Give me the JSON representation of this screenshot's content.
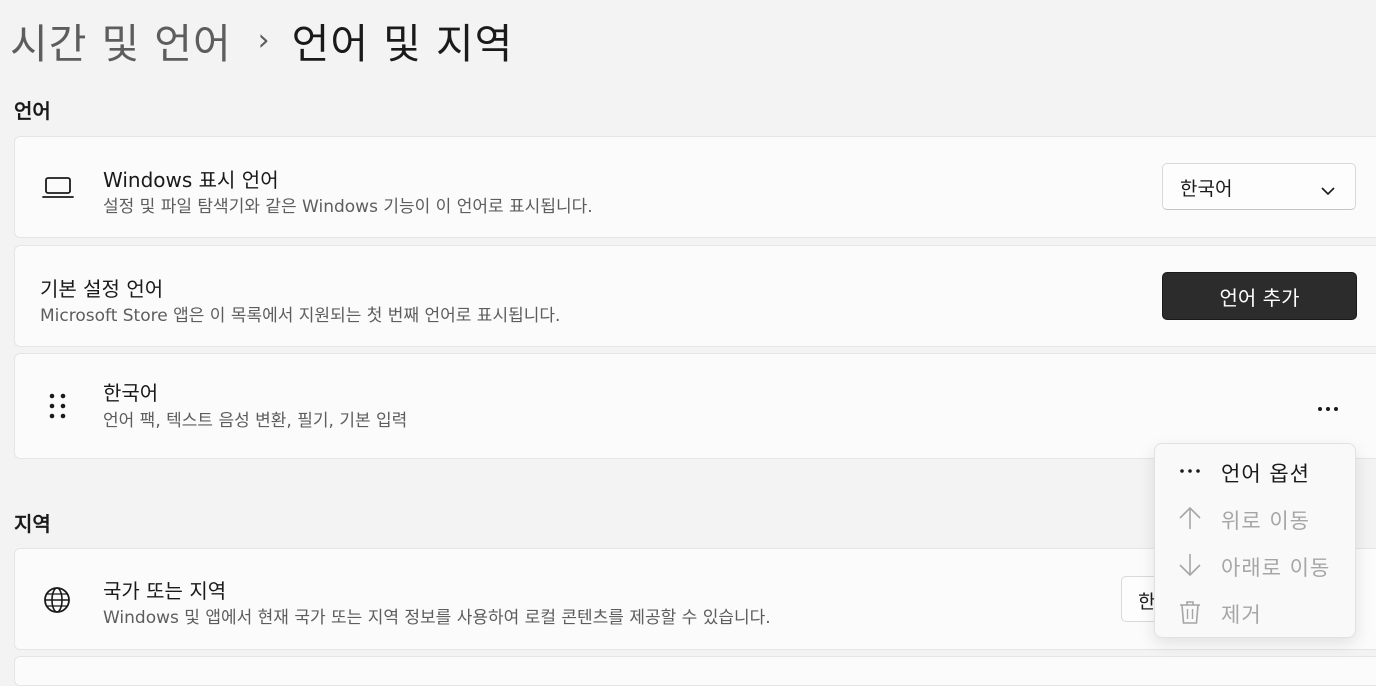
{
  "breadcrumb": {
    "parent": "시간 및 언어",
    "separator": "›",
    "current": "언어 및 지역"
  },
  "language_section": {
    "title": "언어",
    "display_language": {
      "icon": "laptop-icon",
      "title": "Windows 표시 언어",
      "description": "설정 및 파일 탐색기와 같은 Windows 기능이 이 언어로 표시됩니다.",
      "selected": "한국어"
    },
    "preferred_languages": {
      "title": "기본 설정 언어",
      "description": "Microsoft Store 앱은 이 목록에서 지원되는 첫 번째 언어로 표시됩니다.",
      "add_button": "언어 추가"
    },
    "language_item": {
      "icon": "drag-handle-icon",
      "title": "한국어",
      "description": "언어 팩, 텍스트 음성 변환, 필기, 기본 입력",
      "more_icon": "more-icon"
    }
  },
  "region_section": {
    "title": "지역",
    "country": {
      "icon": "globe-icon",
      "title": "국가 또는 지역",
      "description": "Windows 및 앱에서 현재 국가 또는 지역 정보를 사용하여 로컬 콘텐츠를 제공할 수 있습니다.",
      "selected_partial": "한"
    }
  },
  "context_menu": {
    "items": [
      {
        "label": "언어 옵션",
        "icon": "more-icon",
        "enabled": true
      },
      {
        "label": "위로 이동",
        "icon": "arrow-up-icon",
        "enabled": false
      },
      {
        "label": "아래로 이동",
        "icon": "arrow-down-icon",
        "enabled": false
      },
      {
        "label": "제거",
        "icon": "trash-icon",
        "enabled": false
      }
    ]
  },
  "colors": {
    "background": "#f3f3f3",
    "card": "#fbfbfb",
    "primary_button": "#2c2c2c",
    "disabled_text": "#a6a6a6"
  }
}
